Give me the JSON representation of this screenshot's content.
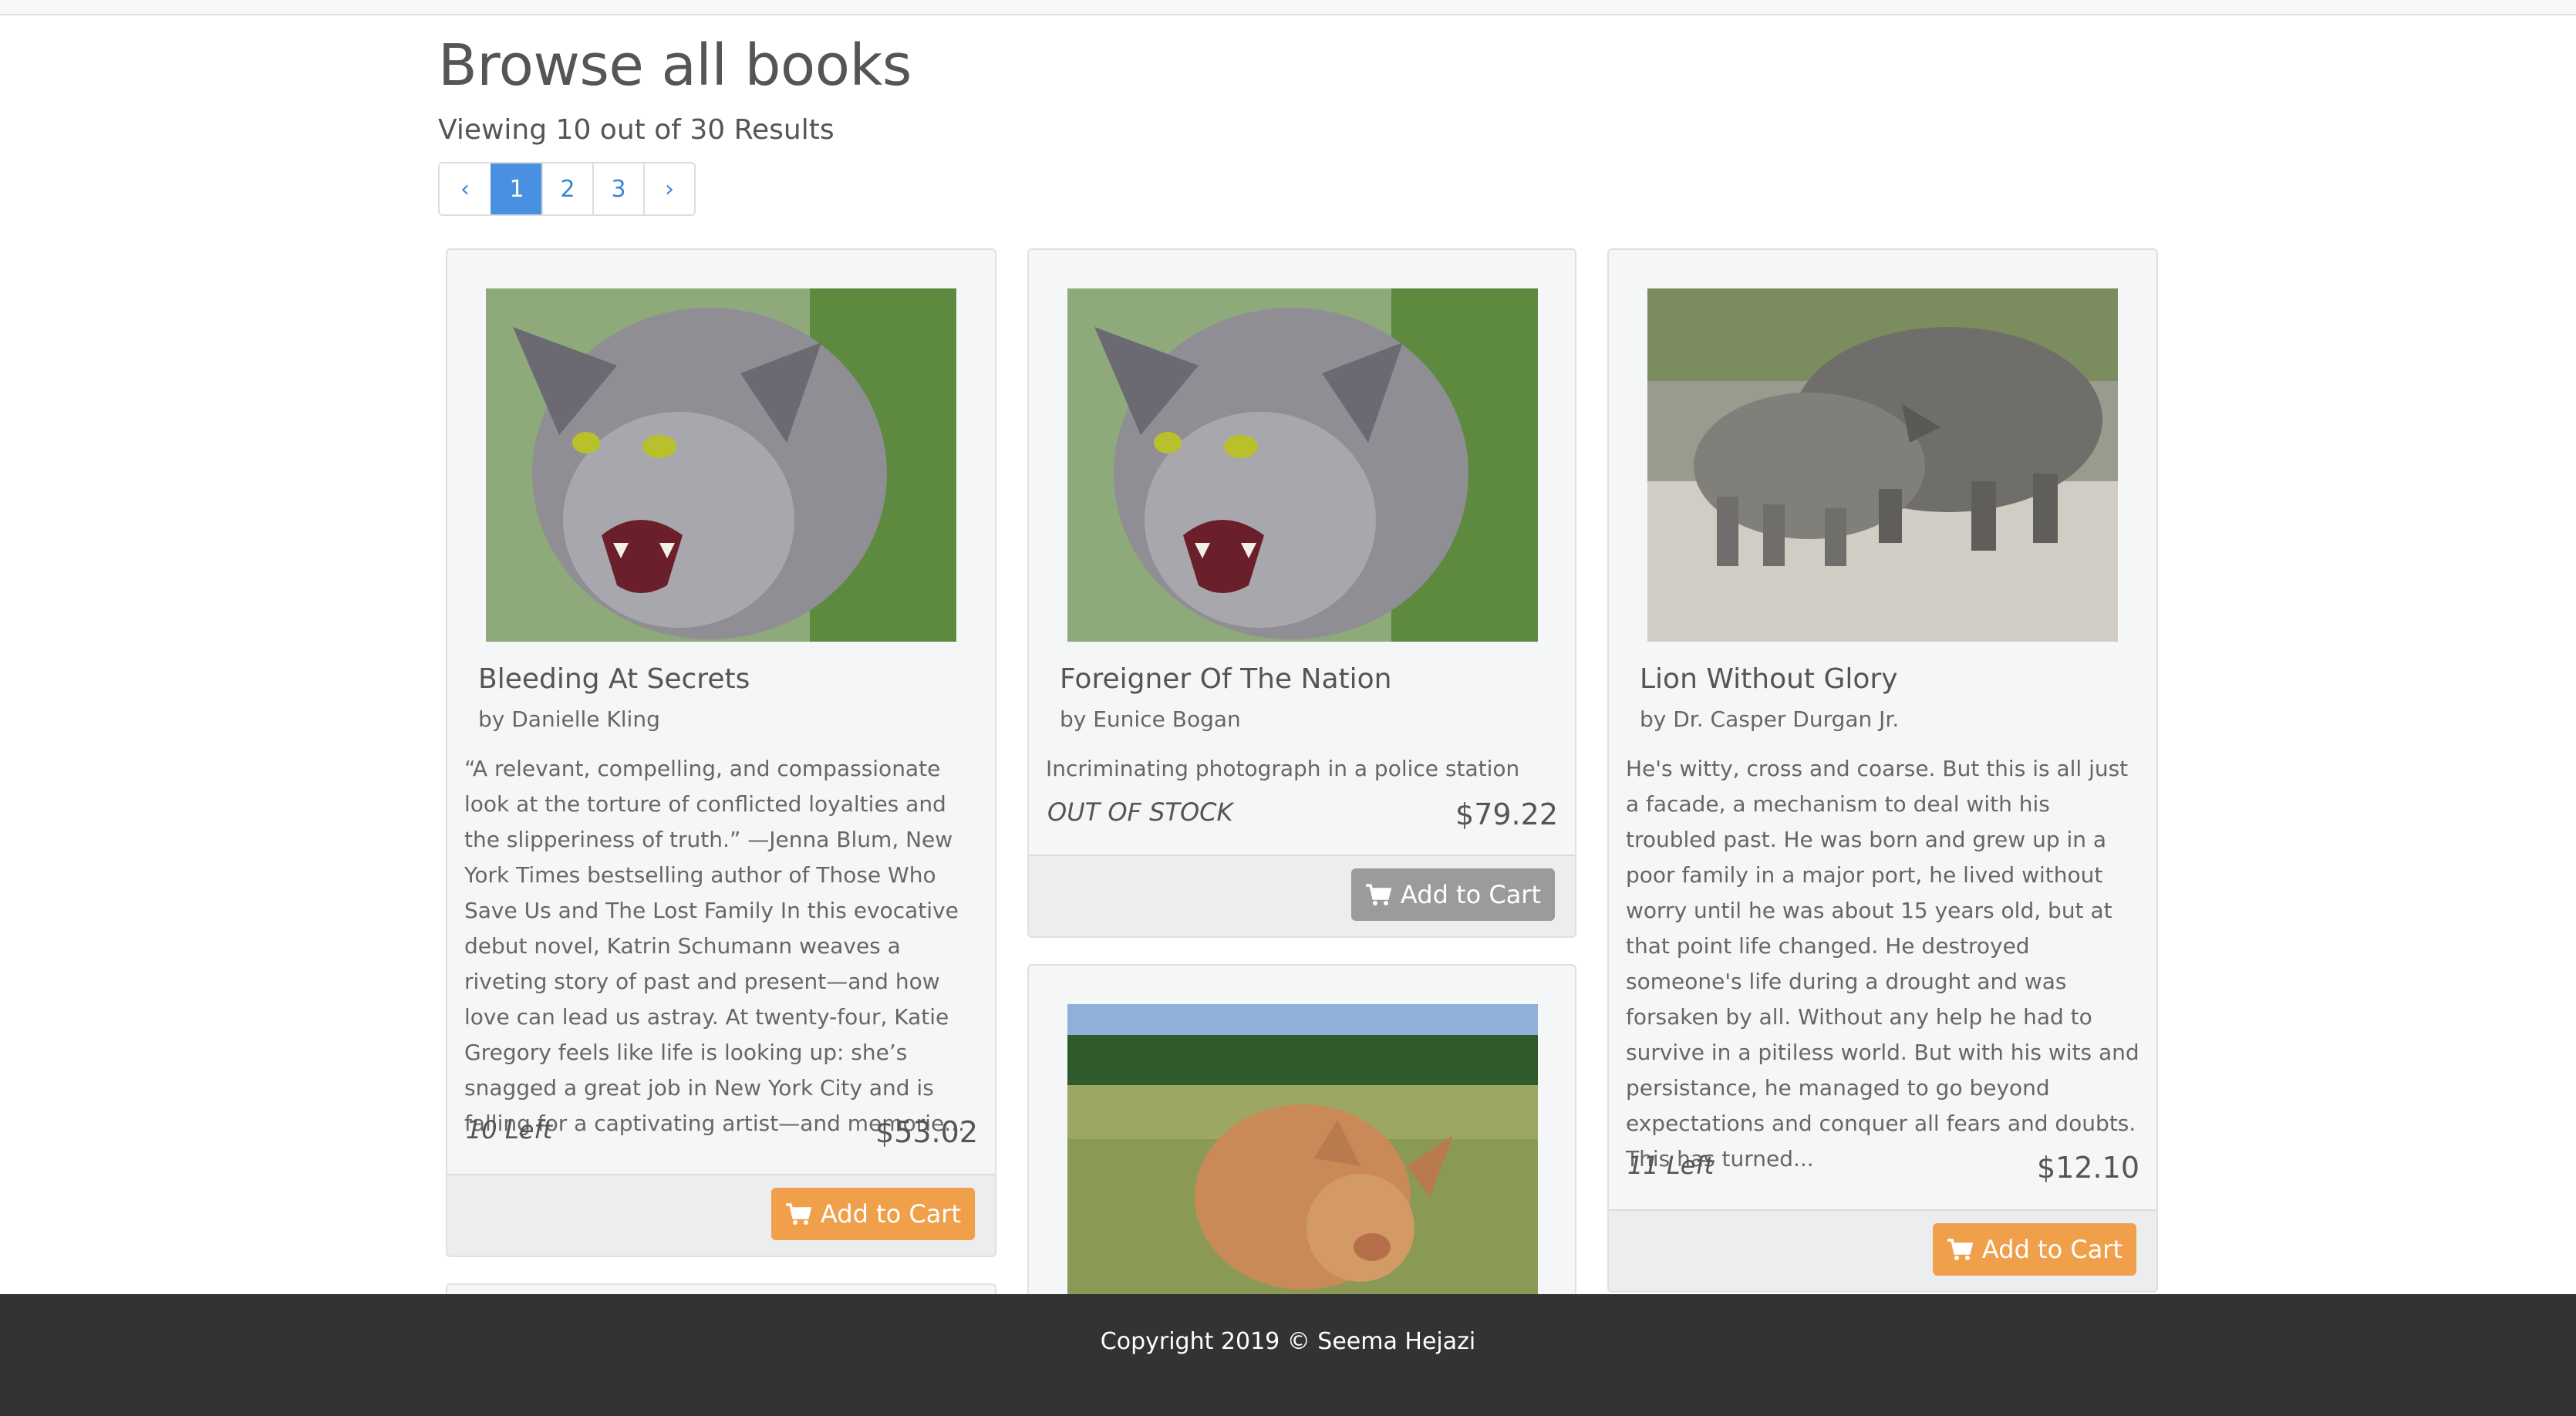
{
  "header": {
    "title": "Browse all books",
    "results": "Viewing 10 out of 30 Results"
  },
  "pagination": {
    "prev": "‹",
    "pages": [
      "1",
      "2",
      "3"
    ],
    "next": "›",
    "active": "1"
  },
  "books": [
    {
      "title": "Bleeding At Secrets",
      "author": "by Danielle Kling",
      "description": "“A relevant, compelling, and compassionate look at the torture of conflicted loyalties and the slipperiness of truth.” —Jenna Blum, New York Times bestselling author of Those Who Save Us and The Lost Family In this evocative debut novel, Katrin Schumann weaves a riveting story of past and present—and how love can lead us astray. At twenty-four, Katie Gregory feels like life is looking up: she’s snagged a great job in New York City and is falling for a captivating artist—and memorie...",
      "stock": "10 Left",
      "price": "$53.02",
      "button": "Add to Cart",
      "image": "cat-photo"
    },
    {
      "title": "Foreigner Of The Nation",
      "author": "by Eunice Bogan",
      "description": "Incriminating photograph in a police station",
      "stock": "OUT OF STOCK",
      "price": "$79.22",
      "button": "Add to Cart",
      "image": "cat-photo"
    },
    {
      "title": "Lion Without Glory",
      "author": "by Dr. Casper Durgan Jr.",
      "description": "He's witty, cross and coarse. But this is all just a facade, a mechanism to deal with his troubled past. He was born and grew up in a poor family in a major port, he lived without worry until he was about 15 years old, but at that point life changed. He destroyed someone's life during a drought and was forsaken by all. Without any help he had to survive in a pitiless world. But with his wits and persistance, he managed to go beyond expectations and conquer all fears and doubts. This has turned...",
      "stock": "11 Left",
      "price": "$12.10",
      "button": "Add to Cart",
      "image": "rhino-photo"
    },
    {
      "image": "pig-photo"
    }
  ],
  "colors": {
    "accent": "#4a90e2",
    "cart_button": "#f0a04b",
    "disabled_button": "#9a9b9d",
    "footer_bg": "#333333"
  },
  "icons": {
    "cart": "cart-icon"
  },
  "footer": {
    "copyright": "Copyright 2019 © Seema Hejazi"
  }
}
